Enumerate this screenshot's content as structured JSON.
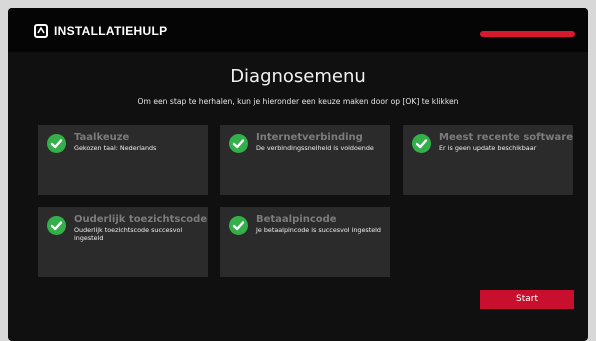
{
  "header": {
    "logo_icon": "installation-badge-icon",
    "title": "INSTALLATIEHULP",
    "progress_percent": 100,
    "progress_color": "#c8102e"
  },
  "main": {
    "title": "Diagnosemenu",
    "subtitle": "Om een stap te herhalen, kun je hieronder een keuze maken door op [OK] te klikken"
  },
  "steps": [
    {
      "title": "Taalkeuze",
      "description": "Gekozen taal: Nederlands",
      "status_icon": "check-circle-icon"
    },
    {
      "title": "Internetverbinding",
      "description": "De verbindingssnelheid is voldoende",
      "status_icon": "check-circle-icon"
    },
    {
      "title": "Meest recente software",
      "description": "Er is geen update beschikbaar",
      "status_icon": "check-circle-icon"
    },
    {
      "title": "Ouderlijk toezichtscode",
      "description": "Ouderlijk toezichtscode succesvol ingesteld",
      "status_icon": "check-circle-icon"
    },
    {
      "title": "Betaalpincode",
      "description": "Je betaalpincode is succesvol ingesteld",
      "status_icon": "check-circle-icon"
    }
  ],
  "actions": {
    "start_label": "Start"
  },
  "colors": {
    "accent": "#c8102e",
    "success": "#34b04a",
    "card_bg": "#2b2b2b",
    "screen_bg": "#101010"
  }
}
